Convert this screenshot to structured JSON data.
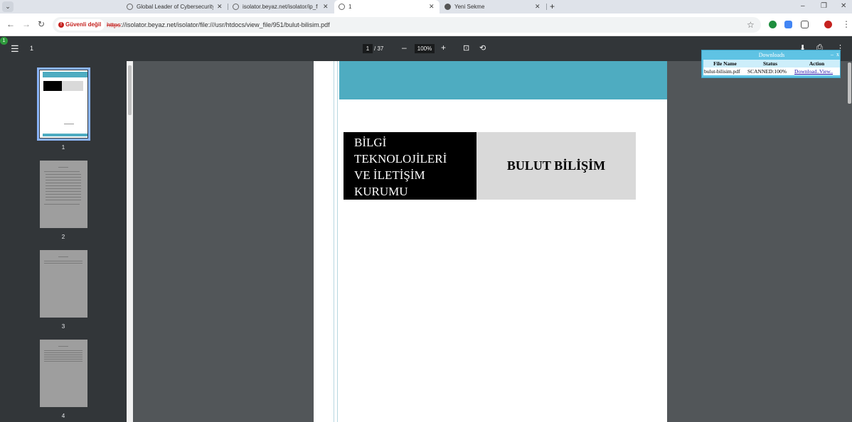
{
  "tabs": [
    {
      "title": "Global Leader of Cybersecurity",
      "active": false
    },
    {
      "title": "isolator.beyaz.net/isolator/ip_fi",
      "active": false
    },
    {
      "title": "1",
      "active": true
    },
    {
      "title": "Yeni Sekme",
      "active": false
    }
  ],
  "tabstrip": {
    "menu_glyph": "⌄",
    "new_tab_glyph": "+",
    "minimize": "–",
    "restore": "❐",
    "close": "✕",
    "tab_close": "✕"
  },
  "address_bar": {
    "back": "←",
    "forward": "→",
    "reload": "↻",
    "security_label": "Güvenli değil",
    "url_scheme": "https",
    "url_rest": "://isolator.beyaz.net/isolator/file:///usr/htdocs/view_file/951/bulut-bilisim.pdf",
    "bookmark_glyph": "☆",
    "menu_glyph": "⋮"
  },
  "pdf_toolbar": {
    "indicator": "1",
    "menu_glyph": "☰",
    "title": "1",
    "current_page": "1",
    "total_pages": "/ 37",
    "zoom_out": "–",
    "zoom_level": "100%",
    "zoom_in": "+",
    "fit_glyph": "⊡",
    "rotate_glyph": "⟲",
    "download_glyph": "⬇",
    "print_glyph": "⎙",
    "more_glyph": "⋮"
  },
  "thumbnails": [
    {
      "number": "1",
      "selected": true
    },
    {
      "number": "2",
      "selected": false
    },
    {
      "number": "3",
      "selected": false
    },
    {
      "number": "4",
      "selected": false
    }
  ],
  "page": {
    "institution_lines": [
      "BİLGİ",
      "TEKNOLOJİLERİ",
      "VE İLETİŞİM",
      "KURUMU"
    ],
    "heading": "BULUT BİLİŞİM"
  },
  "downloads": {
    "title": "Downloads",
    "minimize": "–",
    "close": "x",
    "headers": [
      "File Name",
      "Status",
      "Action"
    ],
    "row": {
      "file": "bulut-bilisim.pdf",
      "status": "SCANNED:100%",
      "action": "Download..View.."
    }
  }
}
